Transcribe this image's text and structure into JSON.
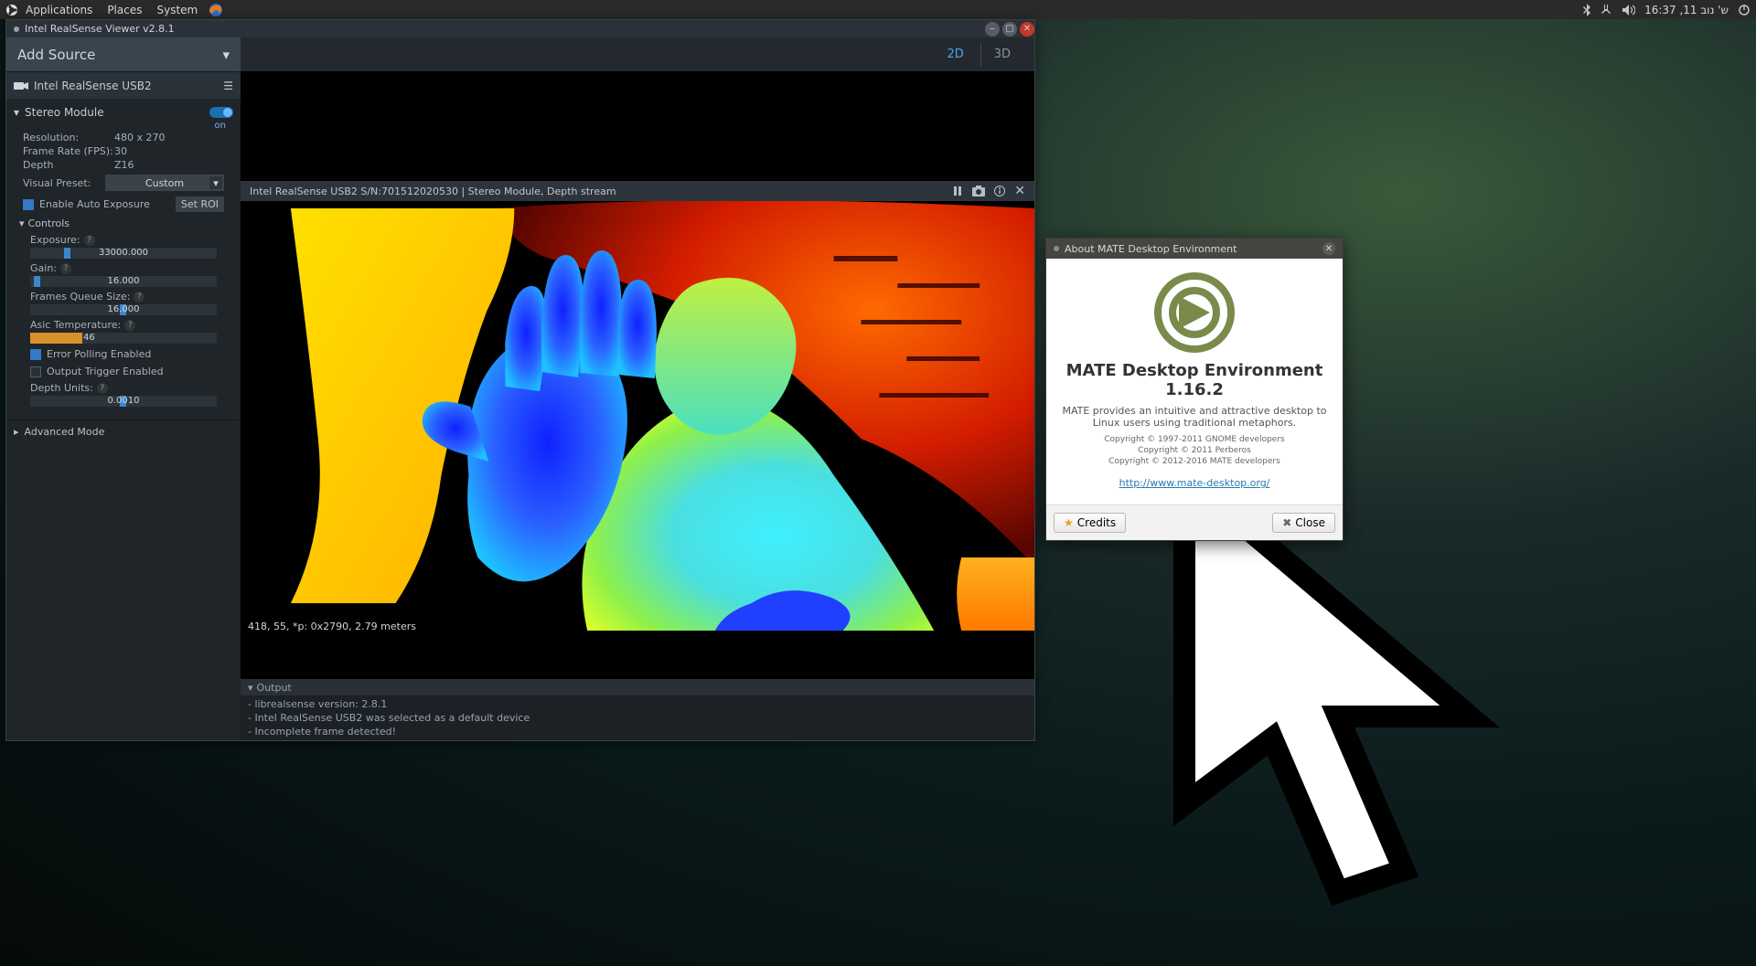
{
  "sysbar": {
    "menus": [
      "Applications",
      "Places",
      "System"
    ],
    "clock": "16:37 ,11 ש' נוב"
  },
  "rswin": {
    "title": "Intel RealSense Viewer v2.8.1",
    "addSource": "Add Source",
    "device": "Intel RealSense USB2",
    "module": {
      "name": "Stereo Module",
      "switch": "on",
      "resolution": {
        "k": "Resolution:",
        "v": "480 x 270"
      },
      "fps": {
        "k": "Frame Rate (FPS):",
        "v": "30"
      },
      "depth": {
        "k": "Depth",
        "v": "Z16"
      },
      "visualPreset": {
        "k": "Visual Preset:",
        "v": "Custom"
      },
      "autoExposure": "Enable Auto Exposure",
      "setRoi": "Set ROI",
      "controls": "Controls",
      "exposure": {
        "label": "Exposure:",
        "value": "33000.000"
      },
      "gain": {
        "label": "Gain:",
        "value": "16.000"
      },
      "framesQueue": {
        "label": "Frames Queue Size:",
        "value": "16.000"
      },
      "asicTemp": {
        "label": "Asic Temperature:",
        "value": "46"
      },
      "errorPolling": "Error Polling Enabled",
      "outputTrigger": "Output Trigger Enabled",
      "depthUnits": {
        "label": "Depth Units:",
        "value": "0.0010"
      },
      "advanced": "Advanced Mode"
    },
    "view": {
      "tab2d": "2D",
      "tab3d": "3D"
    },
    "stream": {
      "header": "Intel RealSense USB2 S/N:701512020530 | Stereo Module, Depth stream",
      "overlay": "418, 55, *p: 0x2790, 2.79 meters"
    },
    "output": {
      "title": "Output",
      "lines": [
        "- librealsense version: 2.8.1",
        "- Intel RealSense USB2 was selected as a default device",
        "- Incomplete frame detected!"
      ]
    }
  },
  "mate": {
    "title": "About MATE Desktop Environment",
    "heading": "MATE Desktop Environment 1.16.2",
    "desc": "MATE provides an intuitive and attractive desktop to Linux users using traditional metaphors.",
    "copy1": "Copyright © 1997-2011 GNOME developers",
    "copy2": "Copyright © 2011 Perberos",
    "copy3": "Copyright © 2012-2016 MATE developers",
    "url": "http://www.mate-desktop.org/",
    "credits": "Credits",
    "close": "Close"
  }
}
